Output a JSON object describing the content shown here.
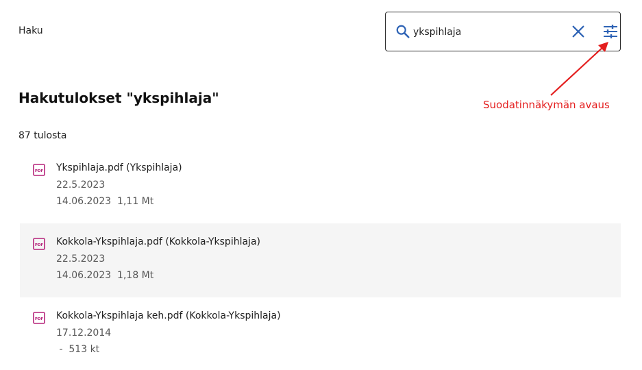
{
  "header": {
    "label": "Haku"
  },
  "search": {
    "value": "ykspihlaja",
    "search_icon": "search-icon",
    "clear_icon": "close-icon",
    "filter_icon": "filter-sliders-icon"
  },
  "annotation": {
    "text": "Suodatinnäkymän avaus",
    "color": "#e41e1e"
  },
  "results": {
    "title": "Hakutulokset \"ykspihlaja\"",
    "count": "87 tulosta",
    "items": [
      {
        "title": "Ykspihlaja.pdf (Ykspihlaja)",
        "date": "22.5.2023",
        "meta": "14.06.2023  1,11 Mt",
        "icon": "pdf-icon"
      },
      {
        "title": "Kokkola-Ykspihlaja.pdf (Kokkola-Ykspihlaja)",
        "date": "22.5.2023",
        "meta": "14.06.2023  1,18 Mt",
        "icon": "pdf-icon"
      },
      {
        "title": "Kokkola-Ykspihlaja keh.pdf (Kokkola-Ykspihlaja)",
        "date": "17.12.2014",
        "meta": " -  513 kt",
        "icon": "pdf-icon"
      }
    ]
  },
  "colors": {
    "accent": "#2e63b5",
    "pdf": "#b5237a",
    "alt_row": "#f5f5f5"
  }
}
